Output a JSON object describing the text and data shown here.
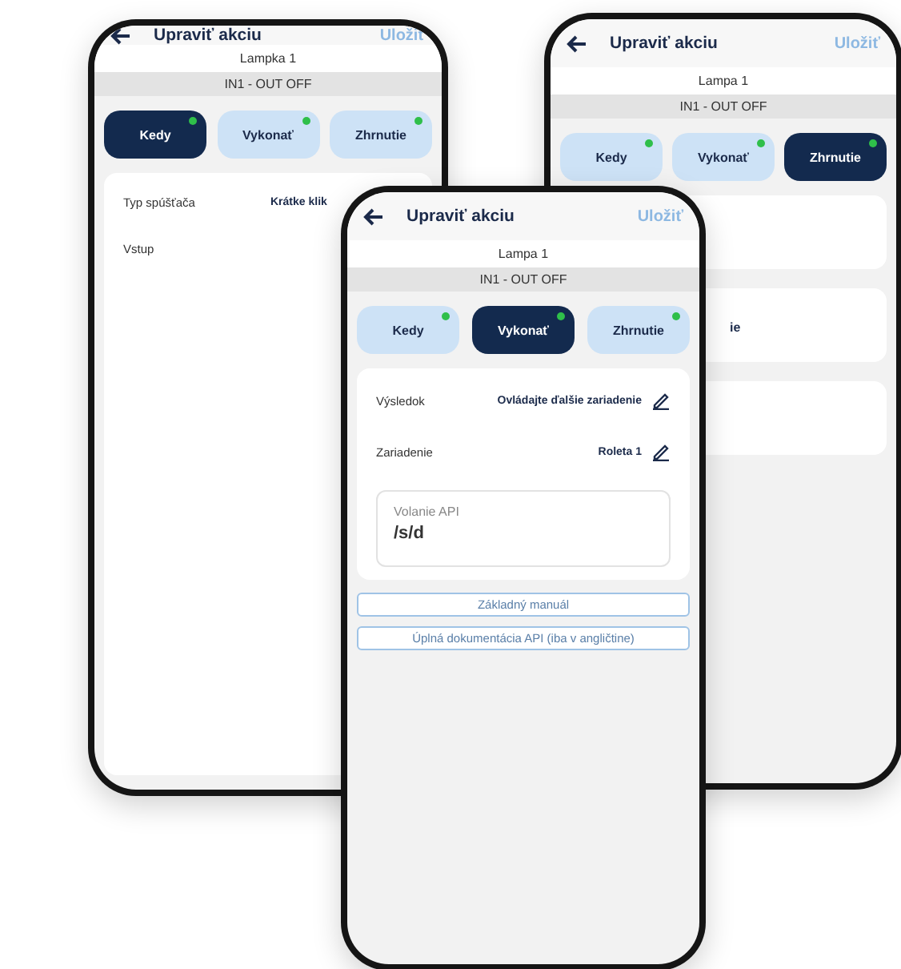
{
  "phones": [
    {
      "title": "Upraviť akciu",
      "save": "Uložiť",
      "device": "Lampka 1",
      "status": "IN1 - OUT OFF",
      "tabs": [
        {
          "label": "Kedy",
          "selected": true
        },
        {
          "label": "Vykonať",
          "selected": false
        },
        {
          "label": "Zhrnutie",
          "selected": false
        }
      ],
      "cards": [
        {
          "fill": true,
          "items": [
            {
              "kind": "row",
              "label": "Typ spúšťača",
              "value": "Krátke klik",
              "editable": false
            },
            {
              "kind": "row",
              "label": "Vstup",
              "editable": false
            }
          ]
        }
      ]
    },
    {
      "title": "Upraviť akciu",
      "save": "Uložiť",
      "device": "Lampa 1",
      "status": "IN1 - OUT OFF",
      "tabs": [
        {
          "label": "Kedy",
          "selected": false
        },
        {
          "label": "Vykonať",
          "selected": false
        },
        {
          "label": "Zhrnutie",
          "selected": true
        }
      ],
      "cards": [
        {
          "fill": false
        },
        {
          "fill": false,
          "items": [
            {
              "kind": "fragment",
              "text": "ie"
            }
          ]
        },
        {
          "fill": false
        }
      ]
    },
    {
      "title": "Upraviť akciu",
      "save": "Uložiť",
      "device": "Lampa 1",
      "status": "IN1 - OUT OFF",
      "tabs": [
        {
          "label": "Kedy",
          "selected": false
        },
        {
          "label": "Vykonať",
          "selected": true
        },
        {
          "label": "Zhrnutie",
          "selected": false
        }
      ],
      "cards": [
        {
          "fill": false,
          "items": [
            {
              "kind": "row",
              "label": "Výsledok",
              "value": "Ovládajte ďalšie zariadenie",
              "editable": true
            },
            {
              "kind": "row",
              "label": "Zariadenie",
              "value": "Roleta 1",
              "editable": true
            },
            {
              "kind": "field",
              "label": "Volanie API",
              "value": "/s/d"
            }
          ]
        }
      ],
      "links": [
        "Základný manuál",
        "Úplná dokumentácia API (iba v angličtine)"
      ]
    }
  ]
}
